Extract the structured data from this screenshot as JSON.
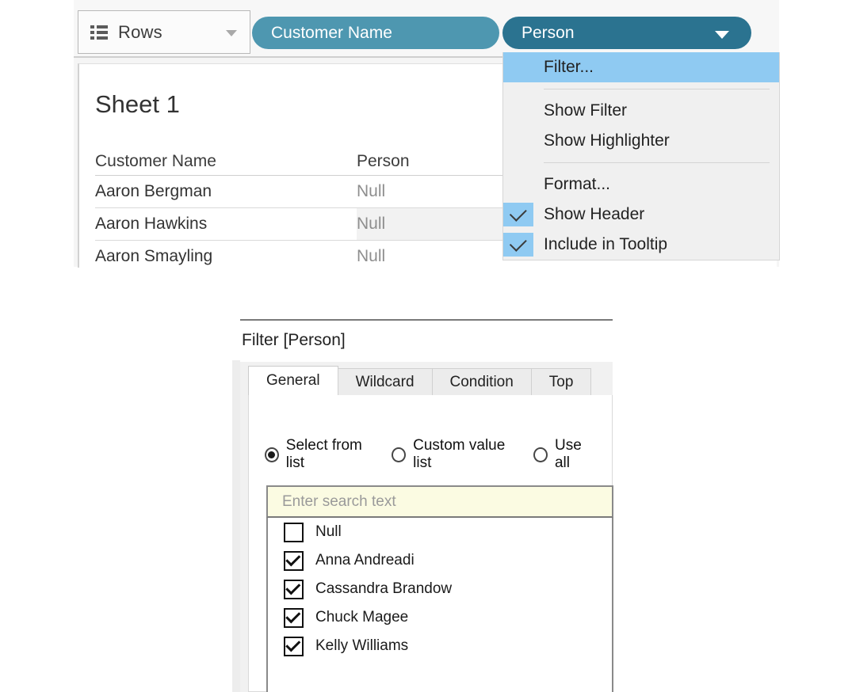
{
  "shelf": {
    "label": "Rows",
    "icon": "rows-icon",
    "dropdown_icon": "chevron-down-icon",
    "pills": [
      {
        "label": "Customer Name",
        "color": "#4e97b0"
      },
      {
        "label": "Person",
        "color": "#2b7390"
      }
    ]
  },
  "worksheet": {
    "title": "Sheet 1",
    "columns": [
      "Customer Name",
      "Person"
    ],
    "rows": [
      {
        "customer_name": "Aaron Bergman",
        "person": "Null",
        "highlighted": false
      },
      {
        "customer_name": "Aaron Hawkins",
        "person": "Null",
        "highlighted": true
      },
      {
        "customer_name": "Aaron Smayling",
        "person": "Null",
        "highlighted": false
      }
    ]
  },
  "context_menu": {
    "items": [
      {
        "label": "Filter...",
        "highlighted": true,
        "checked": false
      },
      {
        "label": "Show Filter",
        "highlighted": false,
        "checked": false
      },
      {
        "label": "Show Highlighter",
        "highlighted": false,
        "checked": false
      },
      {
        "label": "Format...",
        "highlighted": false,
        "checked": false
      },
      {
        "label": "Show Header",
        "highlighted": false,
        "checked": true
      },
      {
        "label": "Include in Tooltip",
        "highlighted": false,
        "checked": true
      }
    ],
    "highlight_color": "#8fcaf2"
  },
  "filter_dialog": {
    "title": "Filter [Person]",
    "tabs": [
      {
        "label": "General",
        "active": true
      },
      {
        "label": "Wildcard",
        "active": false
      },
      {
        "label": "Condition",
        "active": false
      },
      {
        "label": "Top",
        "active": false
      }
    ],
    "radio_options": [
      {
        "label": "Select from list",
        "selected": true
      },
      {
        "label": "Custom value list",
        "selected": false
      },
      {
        "label": "Use all",
        "selected": false
      }
    ],
    "search": {
      "placeholder": "Enter search text",
      "value": "",
      "background": "#fbfbe2"
    },
    "values": [
      {
        "label": "Null",
        "checked": false
      },
      {
        "label": "Anna Andreadi",
        "checked": true
      },
      {
        "label": "Cassandra Brandow",
        "checked": true
      },
      {
        "label": "Chuck Magee",
        "checked": true
      },
      {
        "label": "Kelly Williams",
        "checked": true
      }
    ]
  }
}
